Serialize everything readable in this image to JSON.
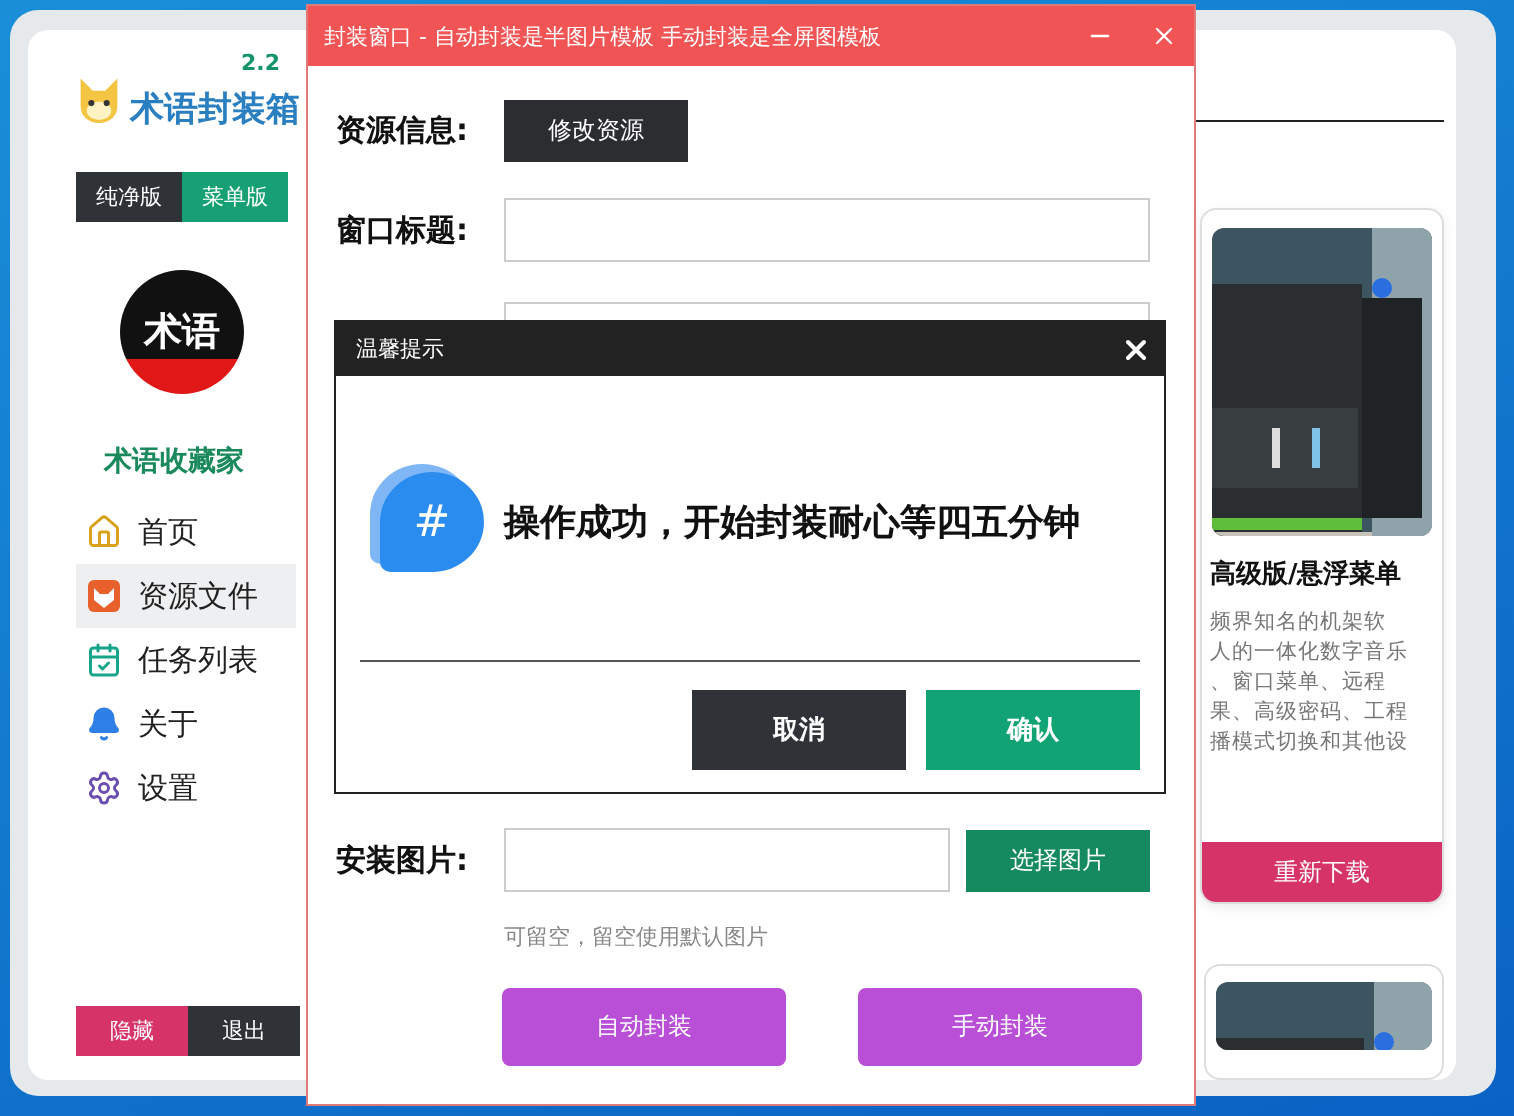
{
  "app": {
    "name": "术语封装箱",
    "version": "2.2",
    "edition_toggle": [
      {
        "label": "纯净版",
        "selected": false
      },
      {
        "label": "菜单版",
        "selected": true
      }
    ],
    "avatar_text": "术语",
    "profile_name": "术语收藏家",
    "nav": [
      {
        "label": "首页",
        "selected": false
      },
      {
        "label": "资源文件",
        "selected": true
      },
      {
        "label": "任务列表",
        "selected": false
      },
      {
        "label": "关于",
        "selected": false
      },
      {
        "label": "设置",
        "selected": false
      }
    ],
    "footer_buttons": [
      {
        "label": "隐藏",
        "kind": "danger"
      },
      {
        "label": "退出",
        "kind": "dark"
      }
    ],
    "card": {
      "title": "高级版/悬浮菜单",
      "description": [
        "频界知名的机架软",
        "人的一体化数字音乐",
        "、窗口菜单、远程",
        "果、高级密码、工程",
        "播模式切换和其他设"
      ],
      "button": "重新下载"
    }
  },
  "package_window": {
    "title": "封装窗口 - 自动封装是半图片模板 手动封装是全屏图模板",
    "resource_label": "资源信息:",
    "resource_button": "修改资源",
    "title_label": "窗口标题:",
    "image_label": "安装图片:",
    "image_button": "选择图片",
    "image_hint": "可留空，留空使用默认图片",
    "actions": [
      "自动封装",
      "手动封装"
    ]
  },
  "dialog": {
    "title": "温馨提示",
    "icon_glyph": "#",
    "message": "操作成功，开始封装耐心等四五分钟",
    "buttons": [
      {
        "label": "取消",
        "kind": "dark"
      },
      {
        "label": "确认",
        "kind": "primary"
      }
    ]
  }
}
